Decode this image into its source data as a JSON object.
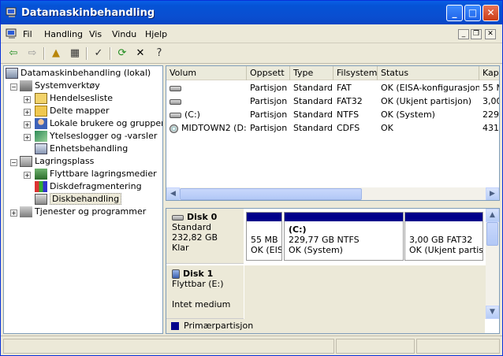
{
  "window": {
    "title": "Datamaskinbehandling"
  },
  "menu": {
    "items": [
      "Fil",
      "Handling",
      "Vis",
      "Vindu",
      "Hjelp"
    ]
  },
  "titlebuttons": {
    "minimize": "_",
    "maximize": "□",
    "close": "✕"
  },
  "mdi": {
    "minimize": "_",
    "restore": "❐",
    "close": "✕"
  },
  "toolbar": {
    "back": "⇦",
    "forward": "⇨",
    "up": "▲",
    "showhide": "▦",
    "properties": "✓",
    "refresh": "⟳",
    "delete": "✕",
    "help": "?"
  },
  "tree": {
    "root": "Datamaskinbehandling (lokal)",
    "systemverktoy": "Systemverktøy",
    "sys_children": [
      "Hendelsesliste",
      "Delte mapper",
      "Lokale brukere og grupper",
      "Ytelseslogger og -varsler",
      "Enhetsbehandling"
    ],
    "lagringsplass": "Lagringsplass",
    "lagr_children": [
      "Flyttbare lagringsmedier",
      "Diskdefragmentering",
      "Diskbehandling"
    ],
    "tjenester": "Tjenester og programmer"
  },
  "list": {
    "columns": [
      "Volum",
      "Oppsett",
      "Type",
      "Filsystem",
      "Status",
      "Kapa"
    ],
    "rows": [
      {
        "volume": "",
        "layout": "Partisjon",
        "type": "Standard",
        "fs": "FAT",
        "status": "OK (EISA-konfigurasjon)",
        "capacity": "55 M"
      },
      {
        "volume": "",
        "layout": "Partisjon",
        "type": "Standard",
        "fs": "FAT32",
        "status": "OK (Ukjent partisjon)",
        "capacity": "3,00"
      },
      {
        "volume": "(C:)",
        "layout": "Partisjon",
        "type": "Standard",
        "fs": "NTFS",
        "status": "OK (System)",
        "capacity": "229,"
      },
      {
        "volume": "MIDTOWN2 (D:)",
        "layout": "Partisjon",
        "type": "Standard",
        "fs": "CDFS",
        "status": "OK",
        "capacity": "431"
      }
    ]
  },
  "disks": [
    {
      "name": "Disk 0",
      "kind": "Standard",
      "size": "232,82 GB",
      "state": "Klar",
      "partitions": [
        {
          "title": "",
          "line1": "55 MB F",
          "line2": "OK (EIS"
        },
        {
          "title": "(C:)",
          "line1": "229,77 GB NTFS",
          "line2": "OK (System)"
        },
        {
          "title": "",
          "line1": "3,00 GB FAT32",
          "line2": "OK (Ukjent partisj"
        }
      ]
    },
    {
      "name": "Disk 1",
      "kind": "Flyttbar (E:)",
      "size": "",
      "state": "Intet medium"
    }
  ],
  "legend": {
    "primary": "Primærpartisjon"
  },
  "colors": {
    "titlebar": "#0553d6",
    "primary_partition": "#00008b"
  }
}
